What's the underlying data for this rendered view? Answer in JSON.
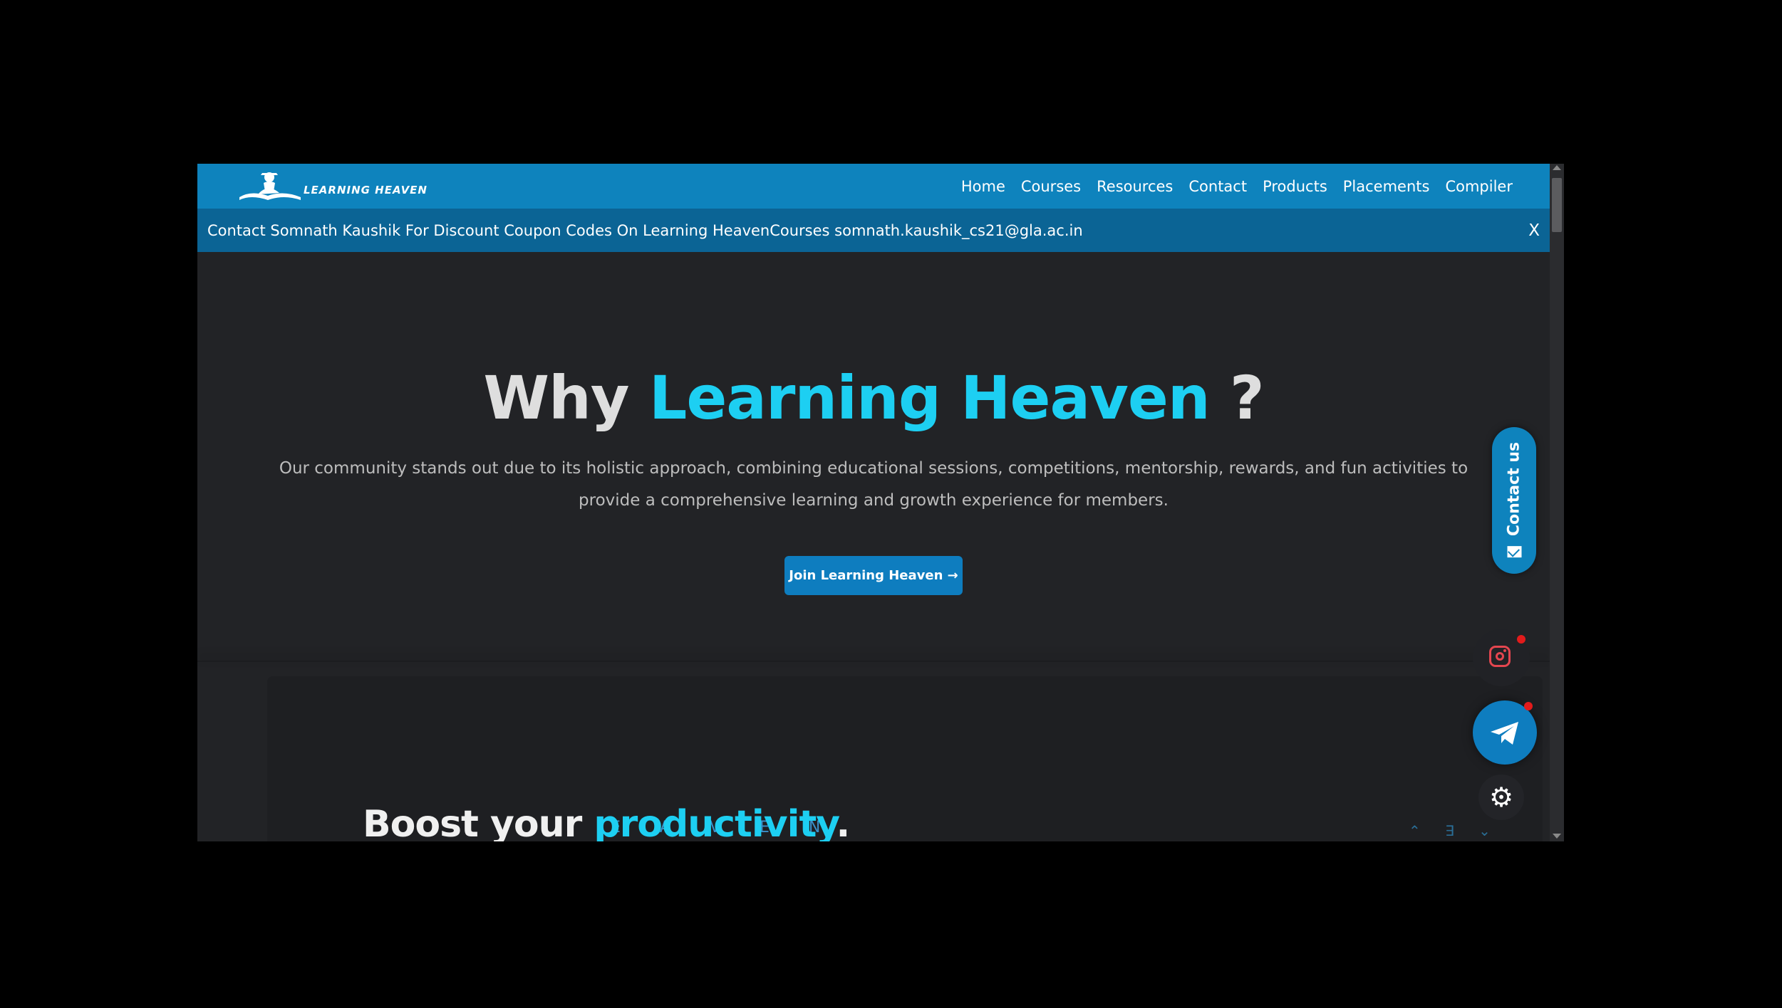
{
  "navbar": {
    "logo_text": "LEARNING HEAVEN",
    "links": [
      "Home",
      "Courses",
      "Resources",
      "Contact",
      "Products",
      "Placements",
      "Compiler"
    ]
  },
  "announcement": {
    "text": "Contact Somnath Kaushik For Discount Coupon Codes On Learning HeavenCourses somnath.kaushik_cs21@gla.ac.in",
    "close_label": "X"
  },
  "hero": {
    "title_prefix": "Why ",
    "title_accent": "Learning Heaven",
    "title_suffix": " ?",
    "description": "Our community stands out due to its holistic approach, combining educational sessions, competitions, mentorship, rewards, and fun activities to provide a comprehensive learning and growth experience for members.",
    "button_label": "Join Learning Heaven →"
  },
  "boost": {
    "title_prefix": "Boost your ",
    "title_accent": "productivity",
    "title_suffix": ".",
    "marquee_text": "E A V E N"
  },
  "floating": {
    "contact_label": "Contact us",
    "icons": [
      "mail-icon",
      "instagram-icon",
      "telegram-icon",
      "gear-icon"
    ],
    "settings_glyph": "⚙"
  },
  "colors": {
    "primary": "#0e83bd",
    "accent": "#1dcff2",
    "background": "#222326",
    "announcement": "#0b6495"
  }
}
